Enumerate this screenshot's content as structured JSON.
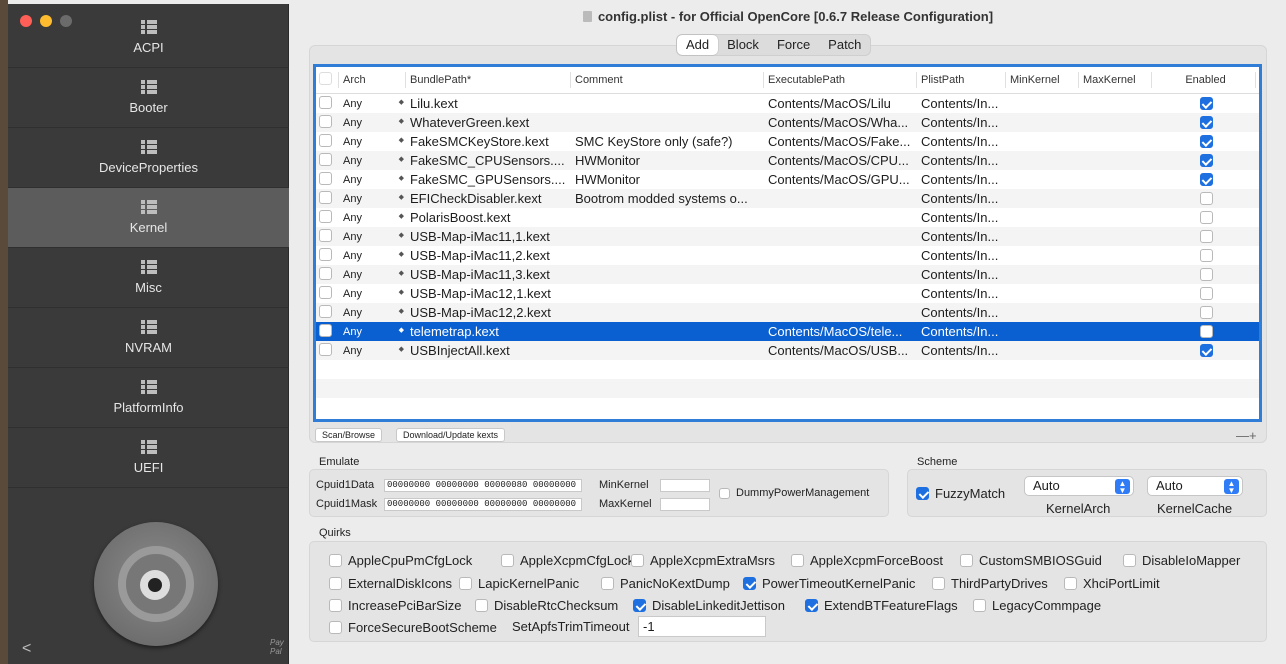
{
  "window": {
    "title": "config.plist - for Official OpenCore [0.6.7 Release Configuration]"
  },
  "sidebar": {
    "items": [
      {
        "label": "ACPI"
      },
      {
        "label": "Booter"
      },
      {
        "label": "DeviceProperties"
      },
      {
        "label": "Kernel"
      },
      {
        "label": "Misc"
      },
      {
        "label": "NVRAM"
      },
      {
        "label": "PlatformInfo"
      },
      {
        "label": "UEFI"
      }
    ],
    "active": "Kernel",
    "paypal": "Pay Pal"
  },
  "tabs": [
    {
      "label": "Add",
      "selected": true
    },
    {
      "label": "Block"
    },
    {
      "label": "Force"
    },
    {
      "label": "Patch"
    }
  ],
  "table": {
    "columns": [
      "Arch",
      "BundlePath*",
      "Comment",
      "ExecutablePath",
      "PlistPath",
      "MinKernel",
      "MaxKernel",
      "Enabled"
    ],
    "rows": [
      {
        "arch": "Any",
        "bundle": "Lilu.kext",
        "comment": "",
        "exec": "Contents/MacOS/Lilu",
        "plist": "Contents/In...",
        "min": "",
        "max": "",
        "enabled": true
      },
      {
        "arch": "Any",
        "bundle": "WhateverGreen.kext",
        "comment": "",
        "exec": "Contents/MacOS/Wha...",
        "plist": "Contents/In...",
        "min": "",
        "max": "",
        "enabled": true
      },
      {
        "arch": "Any",
        "bundle": "FakeSMCKeyStore.kext",
        "comment": "SMC KeyStore only (safe?)",
        "exec": "Contents/MacOS/Fake...",
        "plist": "Contents/In...",
        "min": "",
        "max": "",
        "enabled": true
      },
      {
        "arch": "Any",
        "bundle": "FakeSMC_CPUSensors....",
        "comment": "HWMonitor",
        "exec": "Contents/MacOS/CPU...",
        "plist": "Contents/In...",
        "min": "",
        "max": "",
        "enabled": true
      },
      {
        "arch": "Any",
        "bundle": "FakeSMC_GPUSensors....",
        "comment": "HWMonitor",
        "exec": "Contents/MacOS/GPU...",
        "plist": "Contents/In...",
        "min": "",
        "max": "",
        "enabled": true
      },
      {
        "arch": "Any",
        "bundle": "EFICheckDisabler.kext",
        "comment": "Bootrom modded systems o...",
        "exec": "",
        "plist": "Contents/In...",
        "min": "",
        "max": "",
        "enabled": false
      },
      {
        "arch": "Any",
        "bundle": "PolarisBoost.kext",
        "comment": "",
        "exec": "",
        "plist": "Contents/In...",
        "min": "",
        "max": "",
        "enabled": false
      },
      {
        "arch": "Any",
        "bundle": "USB-Map-iMac11,1.kext",
        "comment": "",
        "exec": "",
        "plist": "Contents/In...",
        "min": "",
        "max": "",
        "enabled": false
      },
      {
        "arch": "Any",
        "bundle": "USB-Map-iMac11,2.kext",
        "comment": "",
        "exec": "",
        "plist": "Contents/In...",
        "min": "",
        "max": "",
        "enabled": false
      },
      {
        "arch": "Any",
        "bundle": "USB-Map-iMac11,3.kext",
        "comment": "",
        "exec": "",
        "plist": "Contents/In...",
        "min": "",
        "max": "",
        "enabled": false
      },
      {
        "arch": "Any",
        "bundle": "USB-Map-iMac12,1.kext",
        "comment": "",
        "exec": "",
        "plist": "Contents/In...",
        "min": "",
        "max": "",
        "enabled": false
      },
      {
        "arch": "Any",
        "bundle": "USB-Map-iMac12,2.kext",
        "comment": "",
        "exec": "",
        "plist": "Contents/In...",
        "min": "",
        "max": "",
        "enabled": false
      },
      {
        "arch": "Any",
        "bundle": "telemetrap.kext",
        "comment": "",
        "exec": "Contents/MacOS/tele...",
        "plist": "Contents/In...",
        "min": "",
        "max": "",
        "enabled": false,
        "selected": true
      },
      {
        "arch": "Any",
        "bundle": "USBInjectAll.kext",
        "comment": "",
        "exec": "Contents/MacOS/USB...",
        "plist": "Contents/In...",
        "min": "",
        "max": "",
        "enabled": true
      }
    ]
  },
  "buttons": {
    "scan": "Scan/Browse",
    "download": "Download/Update kexts",
    "plusminus": "—+"
  },
  "emulate": {
    "title": "Emulate",
    "cpuid1data_label": "Cpuid1Data",
    "cpuid1data": "00000000 00000000 00000080 00000000",
    "cpuid1mask_label": "Cpuid1Mask",
    "cpuid1mask": "00000000 00000000 00000000 00000000",
    "minkernel_label": "MinKernel",
    "maxkernel_label": "MaxKernel",
    "dummy_label": "DummyPowerManagement"
  },
  "scheme": {
    "title": "Scheme",
    "fuzzy_label": "FuzzyMatch",
    "kernelarch_value": "Auto",
    "kernelarch_label": "KernelArch",
    "kernelcache_value": "Auto",
    "kernelcache_label": "KernelCache"
  },
  "quirks": {
    "title": "Quirks",
    "items": [
      {
        "label": "AppleCpuPmCfgLock",
        "on": false
      },
      {
        "label": "AppleXcpmCfgLock",
        "on": false
      },
      {
        "label": "AppleXcpmExtraMsrs",
        "on": false
      },
      {
        "label": "AppleXcpmForceBoost",
        "on": false
      },
      {
        "label": "CustomSMBIOSGuid",
        "on": false
      },
      {
        "label": "DisableIoMapper",
        "on": false
      },
      {
        "label": "ExternalDiskIcons",
        "on": false
      },
      {
        "label": "LapicKernelPanic",
        "on": false
      },
      {
        "label": "PanicNoKextDump",
        "on": false
      },
      {
        "label": "PowerTimeoutKernelPanic",
        "on": true
      },
      {
        "label": "ThirdPartyDrives",
        "on": false
      },
      {
        "label": "XhciPortLimit",
        "on": false
      },
      {
        "label": "IncreasePciBarSize",
        "on": false
      },
      {
        "label": "DisableRtcChecksum",
        "on": false
      },
      {
        "label": "DisableLinkeditJettison",
        "on": true
      },
      {
        "label": "ExtendBTFeatureFlags",
        "on": true
      },
      {
        "label": "LegacyCommpage",
        "on": false
      },
      {
        "label": "ForceSecureBootScheme",
        "on": false
      }
    ],
    "trim_label": "SetApfsTrimTimeout",
    "trim_value": "-1"
  }
}
